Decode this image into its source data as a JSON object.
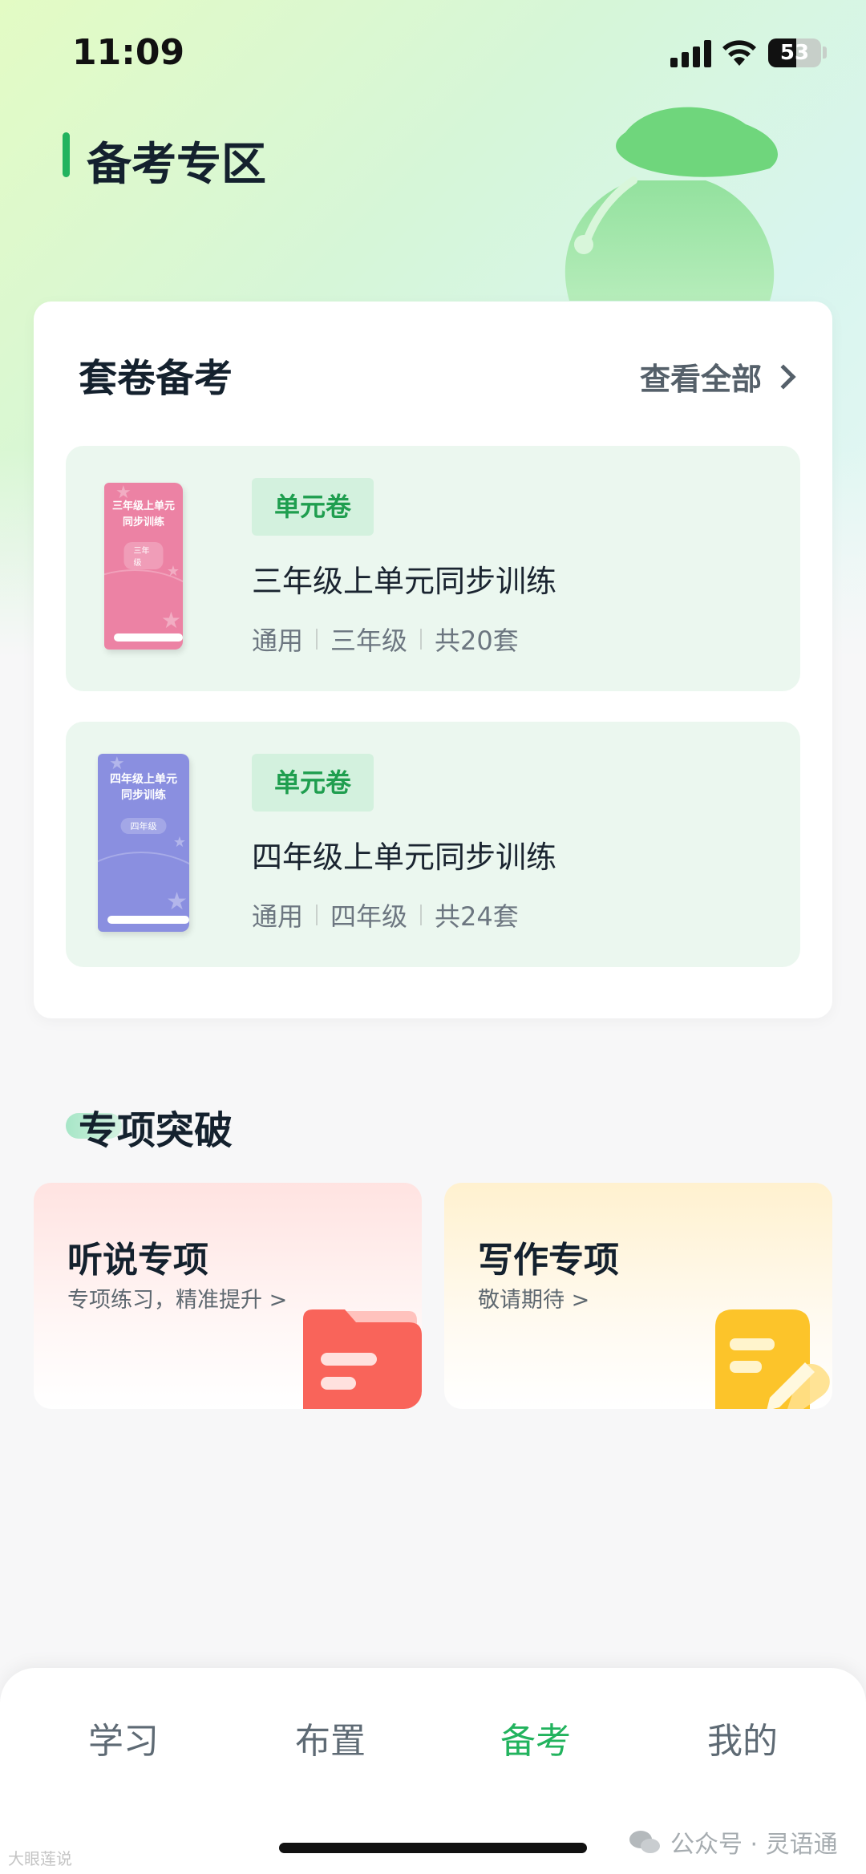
{
  "status_bar": {
    "time": "11:09",
    "battery": "53",
    "battery_level": 0.53
  },
  "page": {
    "title": "备考专区"
  },
  "exam_section": {
    "title": "套卷备考",
    "view_all": "查看全部",
    "items": [
      {
        "badge": "单元卷",
        "title": "三年级上单元同步训练",
        "meta": [
          "通用",
          "三年级",
          "共20套"
        ],
        "cover_title": "三年级上单元同步训练",
        "cover_grade": "三年级",
        "cover_color": "#ec82a4"
      },
      {
        "badge": "单元卷",
        "title": "四年级上单元同步训练",
        "meta": [
          "通用",
          "四年级",
          "共24套"
        ],
        "cover_title": "四年级上单元同步训练",
        "cover_grade": "四年级",
        "cover_color": "#8a8fe0"
      }
    ]
  },
  "special_section": {
    "title": "专项突破",
    "cards": [
      {
        "title": "听说专项",
        "subtitle": "专项练习，精准提升 >",
        "icon": "folder-icon",
        "color": "#f5554a"
      },
      {
        "title": "写作专项",
        "subtitle": "敬请期待 >",
        "icon": "note-pencil-icon",
        "color": "#fdc52a"
      }
    ]
  },
  "tabbar": {
    "items": [
      "学习",
      "布置",
      "备考",
      "我的"
    ],
    "active": "备考",
    "accent": "#22b35e"
  },
  "watermarks": {
    "left": "大眼莲说",
    "right": "公众号 · 灵语通"
  }
}
